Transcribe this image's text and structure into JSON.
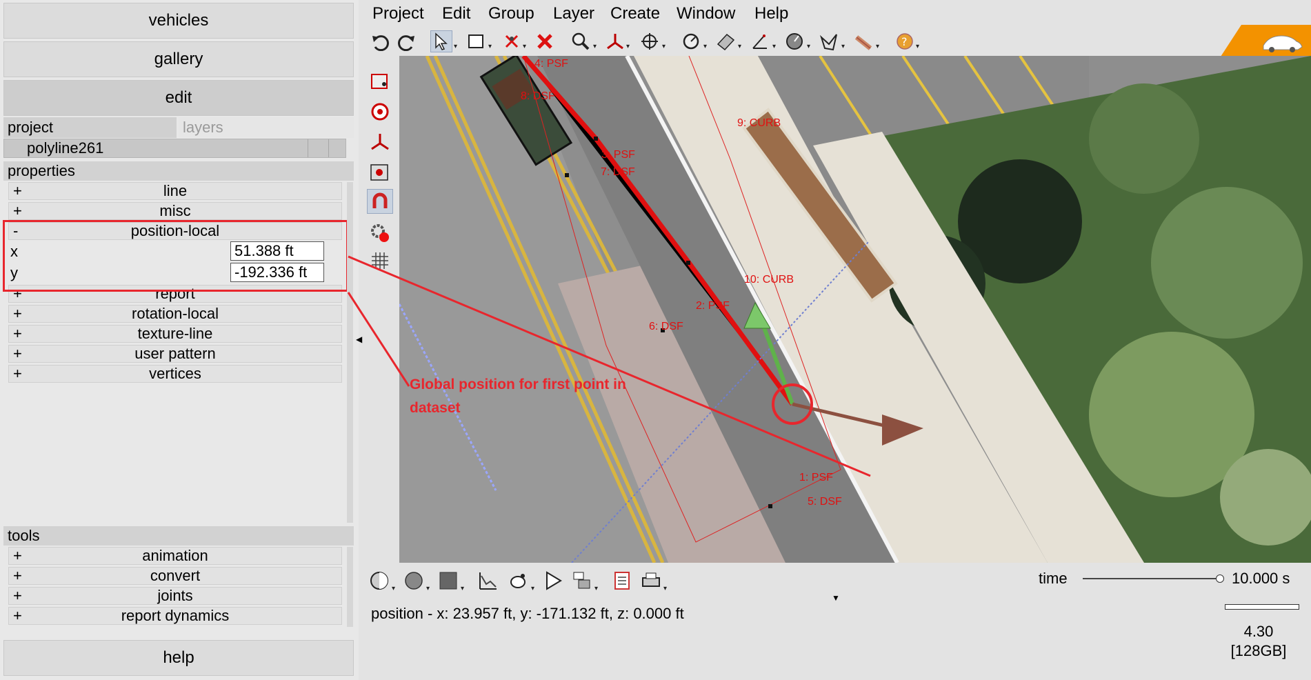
{
  "panel": {
    "buttons": {
      "vehicles": "vehicles",
      "gallery": "gallery",
      "edit": "edit",
      "help": "help"
    },
    "tabs": {
      "project": "project",
      "layers": "layers"
    },
    "selected_object": "polyline261",
    "properties_header": "properties",
    "tools_header": "tools",
    "property_groups": [
      {
        "sign": "+",
        "label": "line"
      },
      {
        "sign": "+",
        "label": "misc"
      },
      {
        "sign": "-",
        "label": "position-local"
      },
      {
        "sign": "+",
        "label": "report"
      },
      {
        "sign": "+",
        "label": "rotation-local"
      },
      {
        "sign": "+",
        "label": "texture-line"
      },
      {
        "sign": "+",
        "label": "user pattern"
      },
      {
        "sign": "+",
        "label": "vertices"
      }
    ],
    "position_local": {
      "x_label": "x",
      "x_value": "51.388 ft",
      "y_label": "y",
      "y_value": "-192.336 ft"
    },
    "tool_groups": [
      {
        "sign": "+",
        "label": "animation"
      },
      {
        "sign": "+",
        "label": "convert"
      },
      {
        "sign": "+",
        "label": "joints"
      },
      {
        "sign": "+",
        "label": "report dynamics"
      }
    ]
  },
  "menubar": [
    "Project",
    "Edit",
    "Group",
    "Layer",
    "Create",
    "Window",
    "Help"
  ],
  "toolbar_icons": [
    "undo-icon",
    "redo-icon",
    "select-arrow-icon",
    "rectangle-select-icon",
    "delete-vertex-icon",
    "delete-icon",
    "zoom-icon",
    "axis-icon",
    "move-icon",
    "measure-icon",
    "surface-icon",
    "angle-icon",
    "gauge-icon",
    "polygon-icon",
    "pencil-icon",
    "help-icon"
  ],
  "viewport": {
    "annotation": "Global position for first point in dataset",
    "labels": [
      "4: PSF",
      "8: DSF",
      "3: PSF",
      "7: DSF",
      "9: CURB",
      "10: CURB",
      "2: PSF",
      "6: DSF",
      "1: PSF",
      "5: DSF"
    ],
    "colors": {
      "annotation_red": "#e8262d",
      "pavement": "#8a8a8a",
      "sidewalk": "#e6e1d6"
    }
  },
  "status": {
    "position": "position - x: 23.957 ft, y: -171.132 ft, z: 0.000 ft",
    "time_label": "time",
    "time_value": "10.000 s",
    "version": "4.30",
    "memory": "[128GB]"
  }
}
